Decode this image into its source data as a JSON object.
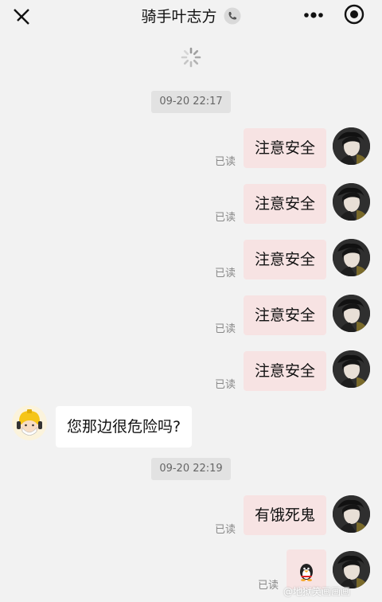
{
  "header": {
    "title": "骑手叶志方",
    "icons": [
      "close-icon",
      "phone-icon",
      "more-icon",
      "target-icon"
    ]
  },
  "timestamps": [
    "09-20 22:17",
    "09-20 22:19"
  ],
  "messages_self": [
    {
      "text": "注意安全",
      "status": "已读"
    },
    {
      "text": "注意安全",
      "status": "已读"
    },
    {
      "text": "注意安全",
      "status": "已读"
    },
    {
      "text": "注意安全",
      "status": "已读"
    },
    {
      "text": "注意安全",
      "status": "已读"
    },
    {
      "text": "有饿死鬼",
      "status": "已读"
    },
    {
      "status": "已读",
      "icon": "penguin-emoji"
    }
  ],
  "message_other": {
    "text": "您那边很危险吗?"
  },
  "watermark": "@地狱笑画画画"
}
